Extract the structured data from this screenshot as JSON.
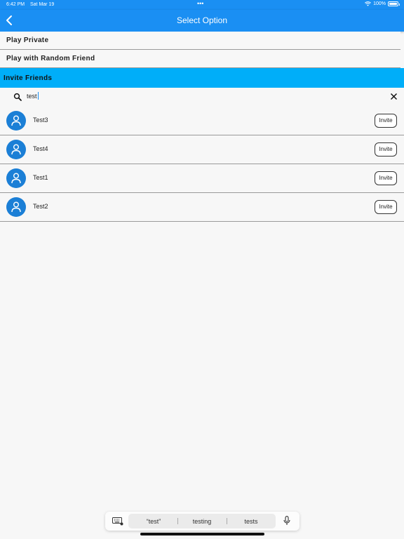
{
  "status_bar": {
    "time": "6:42 PM",
    "date": "Sat Mar 19",
    "dots": "•••",
    "battery_text": "100%",
    "battery_level": 1.0
  },
  "app_bar": {
    "title": "Select Option",
    "back_icon": "chevron-left-icon"
  },
  "options": [
    {
      "label": "Play Private"
    },
    {
      "label": "Play with Random Friend"
    }
  ],
  "invite_section": {
    "header": "Invite Friends"
  },
  "search": {
    "value": "test",
    "search_icon": "search-icon",
    "clear_icon": "close-icon"
  },
  "friends": [
    {
      "name": "Test3",
      "button_label": "Invite"
    },
    {
      "name": "Test4",
      "button_label": "Invite"
    },
    {
      "name": "Test1",
      "button_label": "Invite"
    },
    {
      "name": "Test2",
      "button_label": "Invite"
    }
  ],
  "keyboard": {
    "suggestions": [
      "“test”",
      "testing",
      "tests"
    ],
    "left_icon": "keyboard-icon",
    "right_icon": "microphone-icon"
  },
  "colors": {
    "primary": "#1a8ff3",
    "invite_header": "#00aef9",
    "avatar": "#1b7fd6"
  }
}
